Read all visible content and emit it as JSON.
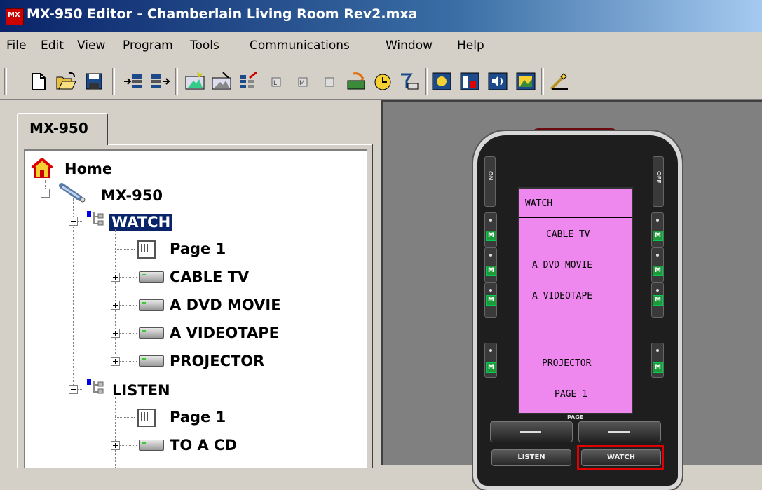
{
  "window": {
    "title": "MX-950 Editor - Chamberlain Living Room Rev2.mxa"
  },
  "menu": [
    "File",
    "Edit",
    "View",
    "Program",
    "Tools",
    "Communications",
    "Window",
    "Help"
  ],
  "toolbar": [
    "new-icon",
    "open-icon",
    "save-icon",
    "import-icon",
    "export-icon",
    "new-device-icon",
    "new-page-icon",
    "new-macro-icon",
    "small-button-icon",
    "macro-button-icon",
    "download-icon",
    "learn-icon",
    "test-ir-icon",
    "display-icon",
    "graphics-icon",
    "sound-icon",
    "image-icon",
    "wand-icon"
  ],
  "left_tab": "MX-950",
  "tree": {
    "home": "Home",
    "remote": "MX-950",
    "watch": "WATCH",
    "watch_page": "Page 1",
    "watch_items": [
      "CABLE TV",
      "A DVD MOVIE",
      "A VIDEOTAPE",
      "PROJECTOR"
    ],
    "listen": "LISTEN",
    "listen_page": "Page 1",
    "listen_items": [
      "TO A CD"
    ]
  },
  "remote": {
    "lcd_title": "WATCH",
    "lcd_items": [
      "CABLE TV",
      "A DVD MOVIE",
      "A VIDEOTAPE",
      "PROJECTOR",
      "PAGE 1"
    ],
    "power_on": "ON",
    "power_off": "OFF",
    "m_label": "M",
    "page_caption": "PAGE",
    "listen_button": "LISTEN",
    "watch_button": "WATCH",
    "highlight_color": "#e00000",
    "lcd_color": "#ee88ee"
  },
  "colors": {
    "titlebar": "#0a246a",
    "selection": "#0a246a",
    "workspace": "#808080"
  }
}
